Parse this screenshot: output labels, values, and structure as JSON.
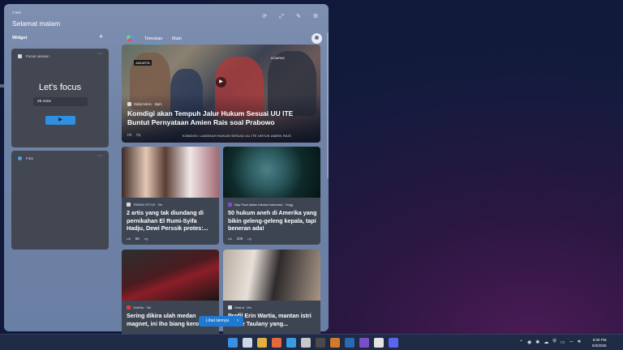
{
  "widgets_panel": {
    "date": "3 Mei",
    "greeting": "Selamat malam",
    "header_icons": [
      "refresh-icon",
      "expand-icon",
      "pin-icon",
      "settings-icon"
    ],
    "widget_section_label": "Widget",
    "add_widget_label": "+",
    "focus_session": {
      "title": "Focus session",
      "heading": "Let's focus",
      "duration": "25 mins",
      "more": "···"
    },
    "photos": {
      "title": "Foto",
      "more": "···"
    }
  },
  "feed": {
    "tabs": [
      "Temukan",
      "Main"
    ],
    "hero": {
      "tag_left": "JAKARTA",
      "tag_right": "KOMPAS",
      "source": "Dailymotion · 5jam",
      "title": "Komdigi akan Tempuh Jalur Hukum Sesuai UU ITE Buntut Pernyataan Amien Rais soal Prabowo",
      "ticker": "KOMDIGI: LANGKAH HUKUM SESUAI UU ITE UNTUK AMIEN RAIS",
      "likes": ""
    },
    "cards": [
      {
        "source": "TRIBUN STYLE · 3hr",
        "title": "2 artis yang tak diundang di pernikahan El Rumi-Syifa Hadju, Dewi Perssik protes:...",
        "likes": "56"
      },
      {
        "source": "Map Pack dalam bahasa Indonesia · 2mgg",
        "title": "50 hukum aneh di Amerika yang bikin geleng-geleng kepala, tapi beneran ada!",
        "likes": "205"
      },
      {
        "source": "GridOto · 3hr",
        "title": "Sering dikira ulah medan magnet, ini Iho biang kerok...",
        "likes": ""
      },
      {
        "source": "GridLsl · 2hr",
        "title": "Profil Erin Wartia, mantan istri Andre Taulany yang...",
        "likes": ""
      }
    ],
    "see_more": "Lihat lainnya"
  },
  "taskbar": {
    "time": "8:00 PM",
    "date": "5/3/2026",
    "app_colors": [
      "#3b8fe0",
      "#cfd6e6",
      "#e0b040",
      "#e4683a",
      "#3a9be0",
      "#c9c9c9",
      "#4a4a4a",
      "#d07a2a",
      "#2a6ab0",
      "#7b4ec9",
      "#e4e4e4",
      "#5865f2"
    ]
  }
}
